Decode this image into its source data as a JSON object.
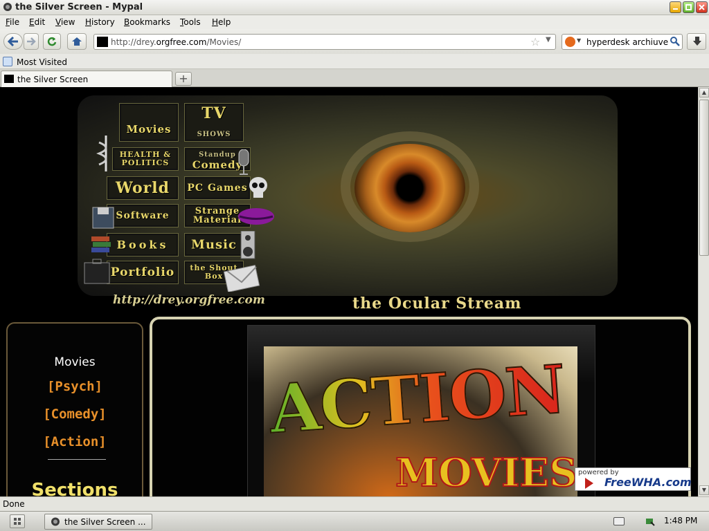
{
  "window": {
    "title": "the Silver Screen - Mypal"
  },
  "menu": {
    "items": [
      "File",
      "Edit",
      "View",
      "History",
      "Bookmarks",
      "Tools",
      "Help"
    ]
  },
  "navbar": {
    "url_prefix": "http://drey.",
    "url_domain": "orgfree.com",
    "url_path": "/Movies/",
    "search_value": "hyperdesk archiuve"
  },
  "bookmarks": {
    "most_visited": "Most Visited"
  },
  "tabs": [
    {
      "title": "the Silver Screen"
    }
  ],
  "page": {
    "banner_buttons": {
      "movies": "Movies",
      "tv": "TV",
      "tv_sub": "SHOWS",
      "health": "HEALTH &",
      "health_sub": "POLITICS",
      "standup": "Standup",
      "comedy": "Comedy",
      "world": "World",
      "pcgames": "PC Games",
      "software": "Software",
      "strange": "Strange",
      "material": "Material",
      "books": "Books",
      "music": "Music",
      "portfolio": "Portfolio",
      "shoutbox": "the Shout",
      "shoutbox_sub": "Box"
    },
    "url_caption": "http://drey.orgfree.com",
    "site_title": "the Ocular Stream",
    "left_nav": {
      "current": "Movies",
      "links": [
        "[Psych]",
        "[Comedy]",
        "[Action]"
      ],
      "sections_heading": "Sections"
    },
    "poster": {
      "title": "ACTION",
      "subtitle": "MOVIES"
    },
    "badge": {
      "powered_by": "powered by",
      "brand": "FreeWHA.com"
    }
  },
  "statusbar": {
    "text": "Done"
  },
  "taskbar": {
    "task_label": "the Silver Screen ...",
    "clock": "1:48 PM"
  },
  "colors": {
    "accent_orange": "#e8902a",
    "gold_text": "#e9d98a",
    "sections_yellow": "#f0e06a"
  }
}
